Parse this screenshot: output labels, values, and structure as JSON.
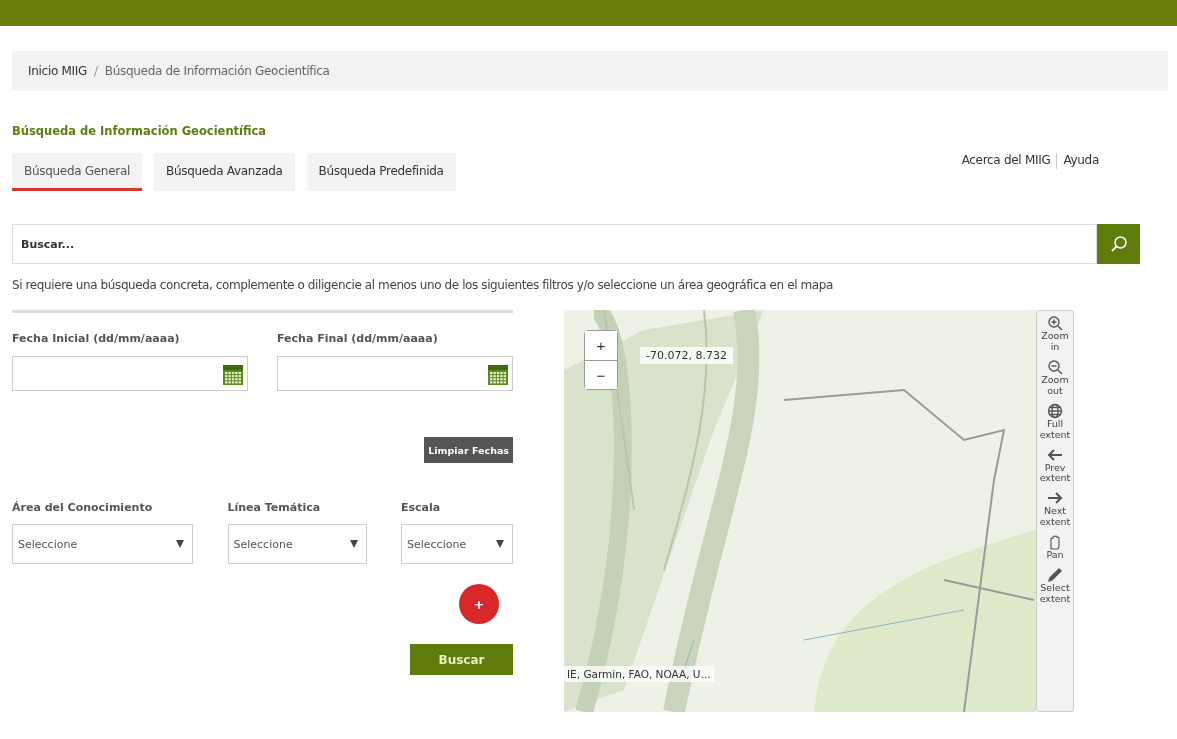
{
  "breadcrumb": [
    {
      "label": "Inicio MIIG",
      "kind": "link"
    },
    {
      "label": "/",
      "kind": "separator"
    },
    {
      "label": "Búsqueda de Información Geocientífica",
      "kind": "current"
    }
  ],
  "page_title": "Búsqueda de Información Geocientífica",
  "tabs": [
    {
      "label": "Búsqueda General",
      "selected": true
    },
    {
      "label": "Búsqueda Avanzada",
      "selected": false
    },
    {
      "label": "Búsqueda Predefinida",
      "selected": false
    }
  ],
  "top_links": [
    "Acerca del MIIG",
    "Ayuda"
  ],
  "search": {
    "placeholder": "Buscar..."
  },
  "hint": "Si requiere una búsqueda concreta, complemente o diligencie al menos uno de los siguientes filtros y/o seleccione un área geográfica en el mapa",
  "date_fields": [
    {
      "label": "Fecha Inicial (dd/mm/aaaa)"
    },
    {
      "label": "Fecha Final (dd/mm/aaaa)"
    }
  ],
  "clear_dates_button": "Limpiar Fechas",
  "selects": [
    {
      "label": "Área del Conocimiento",
      "value": "Seleccione"
    },
    {
      "label": "Línea Temática",
      "value": "Seleccione"
    },
    {
      "label": "Escala",
      "value": "Seleccione"
    }
  ],
  "add_button": "+",
  "search_button": "Buscar",
  "map": {
    "zoom_buttons": [
      "+",
      "−"
    ],
    "coordinates": "-70.072, 8.732",
    "attribution": "IE, Garmin, FAO, NOAA, U...",
    "tools": [
      {
        "kind": "zoom-in",
        "label": "Zoom in"
      },
      {
        "kind": "zoom-out",
        "label": "Zoom out"
      },
      {
        "kind": "full",
        "label": "Full extent"
      },
      {
        "kind": "prev",
        "label": "Prev extent"
      },
      {
        "kind": "next",
        "label": "Next extent"
      },
      {
        "kind": "pan",
        "label": "Pan"
      },
      {
        "kind": "select",
        "label": "Select extent"
      }
    ]
  }
}
